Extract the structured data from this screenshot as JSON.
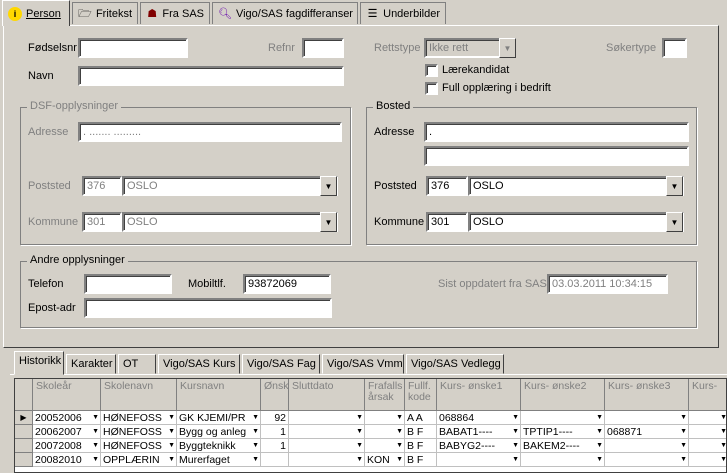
{
  "top_tabs": [
    {
      "label": "Person",
      "icon": "info-icon"
    },
    {
      "label": "Fritekst",
      "icon": "folder-icon"
    },
    {
      "label": "Fra SAS",
      "icon": "people-icon"
    },
    {
      "label": "Vigo/SAS fagdifferanser",
      "icon": "magnifier-icon"
    },
    {
      "label": "Underbilder",
      "icon": "tree-icon"
    }
  ],
  "person": {
    "fodselsnr_label": "Fødselsnr",
    "fodselsnr_value": "",
    "refnr_label": "Refnr",
    "refnr_value": "",
    "rettstype_label": "Rettstype",
    "rettstype_value": "Ikke rett",
    "sokertype_label": "Søkertype",
    "sokertype_value": "",
    "navn_label": "Navn",
    "navn_value": "",
    "laerekandidat_label": "Lærekandidat",
    "full_opplaering_label": "Full opplæring i bedrift"
  },
  "dsf": {
    "title": "DSF-opplysninger",
    "adresse_label": "Adresse",
    "adresse_value": ".   .......  .........",
    "poststed_label": "Poststed",
    "postnr": "376",
    "poststed": "OSLO",
    "kommune_label": "Kommune",
    "kommunenr": "301",
    "kommune": "OSLO"
  },
  "bosted": {
    "title": "Bosted",
    "adresse_label": "Adresse",
    "adresse_value": ".",
    "adresse2_value": "",
    "poststed_label": "Poststed",
    "postnr": "376",
    "poststed": "OSLO",
    "kommune_label": "Kommune",
    "kommunenr": "301",
    "kommune": "OSLO"
  },
  "andre": {
    "title": "Andre opplysninger",
    "telefon_label": "Telefon",
    "telefon_value": "",
    "mobil_label": "Mobiltlf.",
    "mobil_value": "93872069",
    "epost_label": "Epost-adr",
    "epost_value": "",
    "sist_label": "Sist oppdatert fra SAS:",
    "sist_value": "03.03.2011 10:34:15"
  },
  "bottom_tabs": [
    "Historikk",
    "Karakter",
    "OT",
    "Vigo/SAS Kurs",
    "Vigo/SAS Fag",
    "Vigo/SAS Vmm",
    "Vigo/SAS Vedlegg"
  ],
  "grid": {
    "headers": [
      "Skoleår",
      "Skolenavn",
      "Kursnavn",
      "Ønskenr",
      "Sluttdato",
      "Frafalls årsak",
      "Fullf. kode",
      "Kurs- ønske1",
      "Kurs- ønske2",
      "Kurs- ønske3",
      "Kurs-"
    ],
    "rows": [
      [
        "20052006",
        "HØNEFOSS",
        "GK KJEMI/PR",
        "92",
        "",
        "",
        "A A",
        "068864",
        "",
        "",
        ""
      ],
      [
        "20062007",
        "HØNEFOSS",
        "Bygg og anleg",
        "1",
        "",
        "",
        "B F",
        "BABAT1----",
        "TPTIP1----",
        "068871",
        ""
      ],
      [
        "20072008",
        "HØNEFOSS",
        "Byggteknikk",
        "1",
        "",
        "",
        "B F",
        "BABYG2----",
        "BAKEM2----",
        "",
        ""
      ],
      [
        "20082010",
        "OPPLÆRIN",
        "Murerfaget",
        "",
        "",
        "KON",
        "B F",
        "",
        "",
        "",
        ""
      ]
    ]
  }
}
